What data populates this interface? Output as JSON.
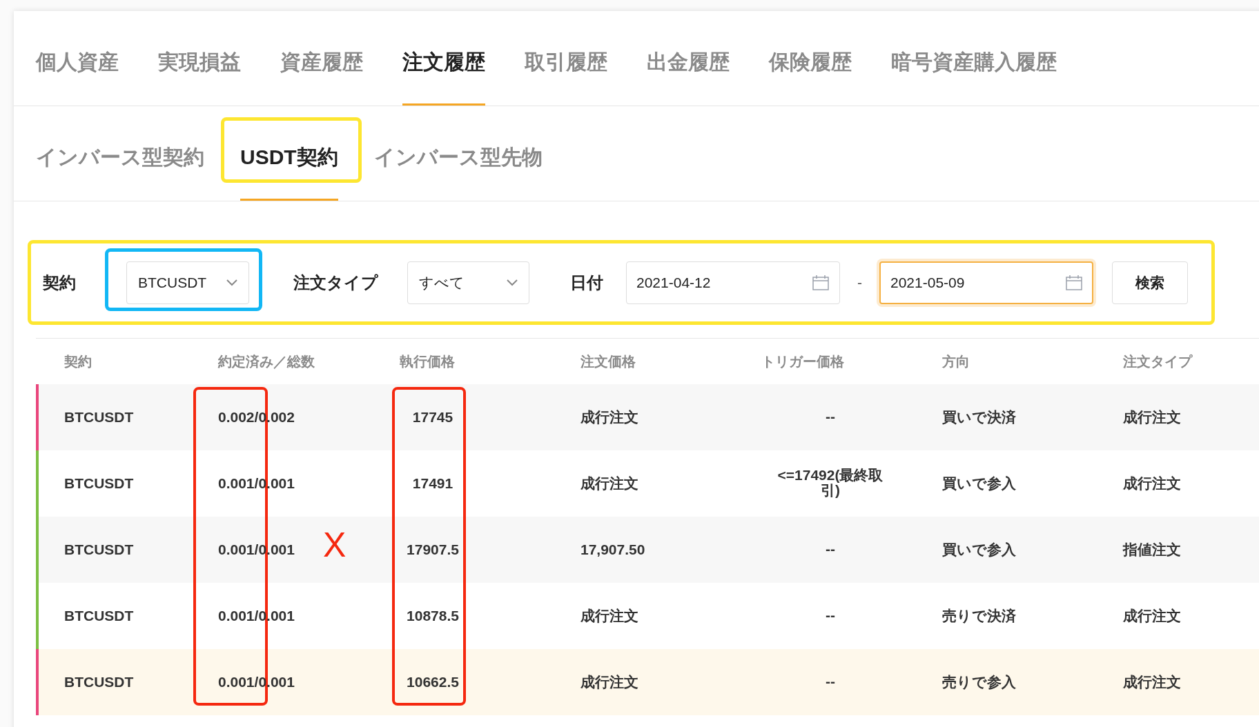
{
  "main_tabs": [
    {
      "label": "個人資産",
      "selected": false
    },
    {
      "label": "実現損益",
      "selected": false
    },
    {
      "label": "資産履歴",
      "selected": false
    },
    {
      "label": "注文履歴",
      "selected": true
    },
    {
      "label": "取引履歴",
      "selected": false
    },
    {
      "label": "出金履歴",
      "selected": false
    },
    {
      "label": "保険履歴",
      "selected": false
    },
    {
      "label": "暗号資産購入履歴",
      "selected": false
    }
  ],
  "sub_tabs": [
    {
      "label": "インバース型契約",
      "selected": false
    },
    {
      "label": "USDT契約",
      "selected": true
    },
    {
      "label": "インバース型先物",
      "selected": false
    }
  ],
  "filters": {
    "contract_label": "契約",
    "contract_value": "BTCUSDT",
    "order_type_label": "注文タイプ",
    "order_type_value": "すべて",
    "date_label": "日付",
    "date_from": {
      "value": "2021-04-12",
      "focused": false
    },
    "separator": "-",
    "date_to": {
      "value": "2021-05-09",
      "focused": true
    },
    "search_button": "検索"
  },
  "table": {
    "columns": [
      "契約",
      "約定済み／総数",
      "執行価格",
      "注文価格",
      "トリガー価格",
      "方向",
      "注文タイプ"
    ],
    "rows": [
      {
        "color": "#e9467c",
        "highlighted": false,
        "cells": [
          "BTCUSDT",
          "0.002/0.002",
          "17745",
          "成行注文",
          "--",
          "買いで決済",
          "成行注文"
        ]
      },
      {
        "color": "#7cc043",
        "highlighted": false,
        "cells": [
          "BTCUSDT",
          "0.001/0.001",
          "17491",
          "成行注文",
          "<=17492(最終取引)",
          "買いで参入",
          "成行注文"
        ]
      },
      {
        "color": "#7cc043",
        "highlighted": false,
        "cells": [
          "BTCUSDT",
          "0.001/0.001",
          "17907.5",
          "17,907.50",
          "--",
          "買いで参入",
          "指値注文"
        ]
      },
      {
        "color": "#7cc043",
        "highlighted": false,
        "cells": [
          "BTCUSDT",
          "0.001/0.001",
          "10878.5",
          "成行注文",
          "--",
          "売りで決済",
          "成行注文"
        ]
      },
      {
        "color": "#e9467c",
        "highlighted": true,
        "cells": [
          "BTCUSDT",
          "0.001/0.001",
          "10662.5",
          "成行注文",
          "--",
          "売りで参入",
          "成行注文"
        ]
      }
    ]
  },
  "annotations": [
    {
      "kind": "box",
      "color": "#fde631"
    },
    {
      "kind": "box",
      "color": "#fde631"
    },
    {
      "kind": "box",
      "color": "#12b7f5"
    },
    {
      "kind": "box",
      "color": "#f5280f"
    },
    {
      "kind": "box",
      "color": "#f5280f"
    },
    {
      "kind": "text",
      "color": "#f5280f",
      "text": "X"
    }
  ]
}
